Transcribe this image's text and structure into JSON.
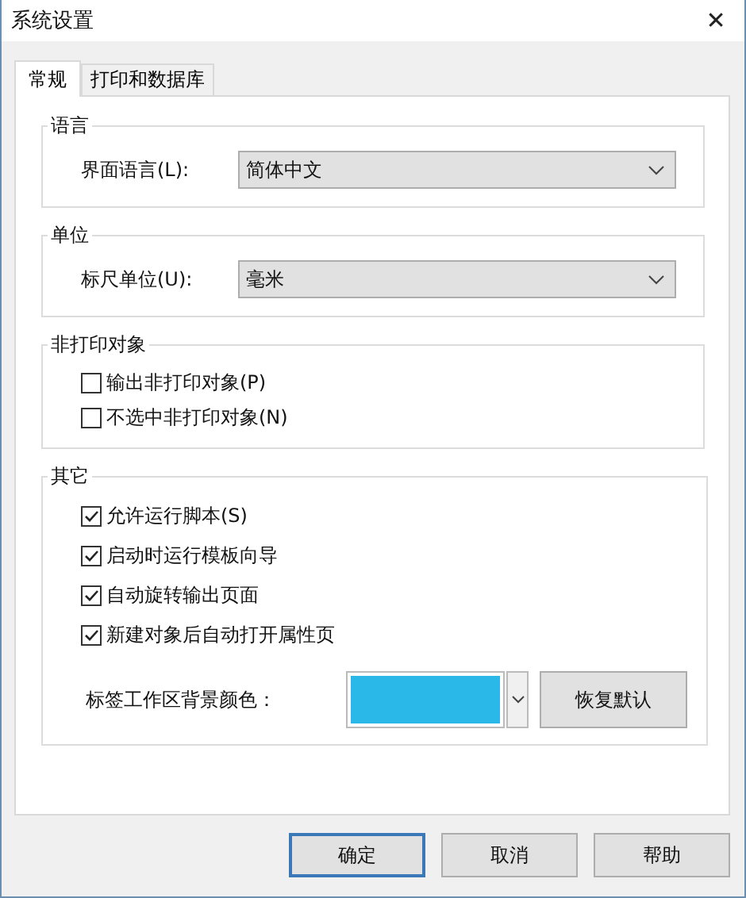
{
  "window": {
    "title": "系统设置",
    "close": "✕"
  },
  "tabs": [
    {
      "label": "常规",
      "selected": true
    },
    {
      "label": "打印和数据库",
      "selected": false
    }
  ],
  "groups": [
    {
      "title": "语言",
      "items": [
        {
          "kind": "select",
          "label": "界面语言(L):",
          "value": "简体中文"
        }
      ]
    },
    {
      "title": "单位",
      "items": [
        {
          "kind": "select",
          "label": "标尺单位(U):",
          "value": "毫米"
        }
      ]
    },
    {
      "title": "非打印对象",
      "items": [
        {
          "kind": "checkbox",
          "label": "输出非打印对象(P)",
          "checked": false
        },
        {
          "kind": "checkbox",
          "label": "不选中非打印对象(N)",
          "checked": false
        }
      ]
    },
    {
      "title": "其它",
      "items": [
        {
          "kind": "checkbox",
          "label": "允许运行脚本(S)",
          "checked": true
        },
        {
          "kind": "checkbox",
          "label": "启动时运行模板向导",
          "checked": true
        },
        {
          "kind": "checkbox",
          "label": "自动旋转输出页面",
          "checked": true
        },
        {
          "kind": "checkbox",
          "label": "新建对象后自动打开属性页",
          "checked": true
        },
        {
          "kind": "color",
          "label": "标签工作区背景颜色：",
          "color": "#29b8e8",
          "button": "恢复默认"
        }
      ]
    }
  ],
  "buttons": [
    {
      "label": "确定",
      "default": true
    },
    {
      "label": "取消",
      "default": false
    },
    {
      "label": "帮助",
      "default": false
    }
  ]
}
